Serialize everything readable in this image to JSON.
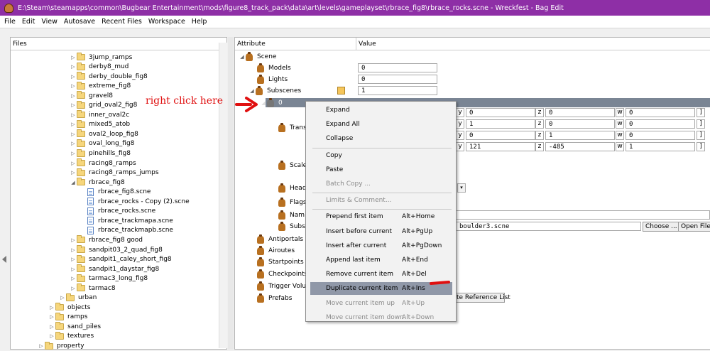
{
  "window": {
    "title": "E:\\Steam\\steamapps\\common\\Bugbear Entertainment\\mods\\figure8_track_pack\\data\\art\\levels\\gameplayset\\rbrace_fig8\\rbrace_rocks.scne - Wreckfest - Bag Edit"
  },
  "menu": [
    "File",
    "Edit",
    "View",
    "Autosave",
    "Recent Files",
    "Workspace",
    "Help"
  ],
  "files": {
    "header": "Files",
    "items": [
      {
        "label": "3jump_ramps",
        "type": "folder",
        "indent": 1
      },
      {
        "label": "derby8_mud",
        "type": "folder",
        "indent": 1
      },
      {
        "label": "derby_double_fig8",
        "type": "folder",
        "indent": 1
      },
      {
        "label": "extreme_fig8",
        "type": "folder",
        "indent": 1
      },
      {
        "label": "gravel8",
        "type": "folder",
        "indent": 1
      },
      {
        "label": "grid_oval2_fig8",
        "type": "folder",
        "indent": 1
      },
      {
        "label": "inner_oval2c",
        "type": "folder",
        "indent": 1
      },
      {
        "label": "mixed5_atob",
        "type": "folder",
        "indent": 1
      },
      {
        "label": "oval2_loop_fig8",
        "type": "folder",
        "indent": 1
      },
      {
        "label": "oval_long_fig8",
        "type": "folder",
        "indent": 1
      },
      {
        "label": "pinehills_fig8",
        "type": "folder",
        "indent": 1
      },
      {
        "label": "racing8_ramps",
        "type": "folder",
        "indent": 1
      },
      {
        "label": "racing8_ramps_jumps",
        "type": "folder",
        "indent": 1
      },
      {
        "label": "rbrace_fig8",
        "type": "folder",
        "indent": 1,
        "expanded": true
      },
      {
        "label": "rbrace_fig8.scne",
        "type": "file",
        "indent": 2
      },
      {
        "label": "rbrace_rocks - Copy (2).scne",
        "type": "file",
        "indent": 2
      },
      {
        "label": "rbrace_rocks.scne",
        "type": "file",
        "indent": 2
      },
      {
        "label": "rbrace_trackmapa.scne",
        "type": "file",
        "indent": 2
      },
      {
        "label": "rbrace_trackmapb.scne",
        "type": "file",
        "indent": 2
      },
      {
        "label": "rbrace_fig8 good",
        "type": "folder",
        "indent": 1
      },
      {
        "label": "sandpit03_2_quad_fig8",
        "type": "folder",
        "indent": 1
      },
      {
        "label": "sandpit1_caley_short_fig8",
        "type": "folder",
        "indent": 1
      },
      {
        "label": "sandpit1_daystar_fig8",
        "type": "folder",
        "indent": 1
      },
      {
        "label": "tarmac3_long_fig8",
        "type": "folder",
        "indent": 1
      },
      {
        "label": "tarmac8",
        "type": "folder",
        "indent": 1
      },
      {
        "label": "urban",
        "type": "folder",
        "indent": 0
      },
      {
        "label": "objects",
        "type": "folder",
        "indent": -1
      },
      {
        "label": "ramps",
        "type": "folder",
        "indent": -1
      },
      {
        "label": "sand_piles",
        "type": "folder",
        "indent": -1
      },
      {
        "label": "textures",
        "type": "folder",
        "indent": -1
      },
      {
        "label": "property",
        "type": "folder",
        "indent": -2
      }
    ]
  },
  "annotation": "right click here",
  "attrs": {
    "col_attribute": "Attribute",
    "col_value": "Value",
    "scene": "Scene",
    "models": "Models",
    "models_val": "0",
    "lights": "Lights",
    "lights_val": "0",
    "subscenes": "Subscenes",
    "subscenes_val": "1",
    "item0": "0",
    "trans": "Trans",
    "scale": "Scale",
    "head": "Head",
    "flags": "Flags",
    "name": "Nam",
    "subsc": "Subsc",
    "antiportals": "Antiportals",
    "airoutes": "Airoutes",
    "startpoints": "Startpoints",
    "checkpoints": "Checkpoints",
    "trigger": "Trigger Volur",
    "prefabs": "Prefabs",
    "matrix": [
      [
        "0",
        "0",
        "0"
      ],
      [
        "1",
        "0",
        "0"
      ],
      [
        "0",
        "1",
        "0"
      ],
      [
        "121",
        "-485",
        "1"
      ]
    ],
    "axis_labels": [
      "y",
      "z",
      "w"
    ],
    "bracket": "]",
    "subscene_file": "boulder3.scne",
    "choose_label": "Choose ...",
    "open_label": "Open File",
    "ref_list_label": "te Reference List"
  },
  "context_menu": [
    {
      "label": "Expand",
      "shortcut": "",
      "disabled": false
    },
    {
      "label": "Expand All",
      "shortcut": "",
      "disabled": false
    },
    {
      "label": "Collapse",
      "shortcut": "",
      "disabled": false
    },
    {
      "sep": true
    },
    {
      "label": "Copy",
      "shortcut": "",
      "disabled": false
    },
    {
      "label": "Paste",
      "shortcut": "",
      "disabled": false
    },
    {
      "label": "Batch Copy ...",
      "shortcut": "",
      "disabled": true
    },
    {
      "sep": true
    },
    {
      "label": "Limits & Comment...",
      "shortcut": "",
      "disabled": true
    },
    {
      "sep": true
    },
    {
      "label": "Prepend first item",
      "shortcut": "Alt+Home",
      "disabled": false
    },
    {
      "label": "Insert before current",
      "shortcut": "Alt+PgUp",
      "disabled": false
    },
    {
      "label": "Insert after current",
      "shortcut": "Alt+PgDown",
      "disabled": false
    },
    {
      "label": "Append last item",
      "shortcut": "Alt+End",
      "disabled": false
    },
    {
      "label": "Remove current item",
      "shortcut": "Alt+Del",
      "disabled": false
    },
    {
      "label": "Duplicate current item",
      "shortcut": "Alt+Ins",
      "disabled": false,
      "highlighted": true
    },
    {
      "label": "Move current item up",
      "shortcut": "Alt+Up",
      "disabled": true
    },
    {
      "label": "Move current item down",
      "shortcut": "Alt+Down",
      "disabled": true
    }
  ],
  "colors": {
    "title_bar": "#8e2fa6",
    "selection": "#7a8594",
    "highlight": "#9098a8",
    "annotation": "#e01010"
  }
}
